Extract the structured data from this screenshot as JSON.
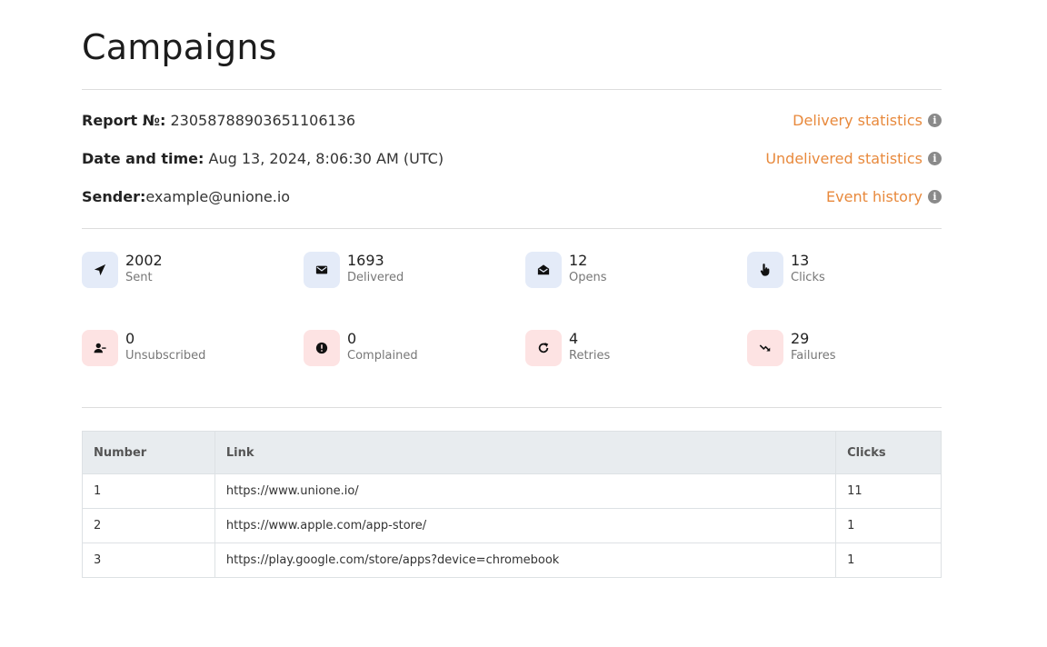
{
  "page": {
    "title": "Campaigns"
  },
  "info": {
    "report": {
      "label": "Report №:",
      "value": "23058788903651106136"
    },
    "datetime": {
      "label": "Date and time:",
      "value": "Aug 13, 2024, 8:06:30 AM (UTC)"
    },
    "sender": {
      "label": "Sender:",
      "value": "example@unione.io"
    },
    "links": {
      "delivery": "Delivery statistics",
      "undelivered": "Undelivered statistics",
      "events": "Event history"
    }
  },
  "stats": [
    {
      "value": "2002",
      "label": "Sent",
      "icon": "send-icon",
      "tone": "blue"
    },
    {
      "value": "1693",
      "label": "Delivered",
      "icon": "envelope-icon",
      "tone": "blue"
    },
    {
      "value": "12",
      "label": "Opens",
      "icon": "envelope-open-icon",
      "tone": "blue"
    },
    {
      "value": "13",
      "label": "Clicks",
      "icon": "pointer-hand-icon",
      "tone": "blue"
    },
    {
      "value": "0",
      "label": "Unsubscribed",
      "icon": "user-minus-icon",
      "tone": "red"
    },
    {
      "value": "0",
      "label": "Complained",
      "icon": "alert-circle-icon",
      "tone": "red"
    },
    {
      "value": "4",
      "label": "Retries",
      "icon": "retry-icon",
      "tone": "red"
    },
    {
      "value": "29",
      "label": "Failures",
      "icon": "trend-down-icon",
      "tone": "red"
    }
  ],
  "colors": {
    "accent": "#e8893c",
    "blue_tile": "#e4ebf8",
    "red_tile": "#fde3e3"
  },
  "table": {
    "headers": {
      "number": "Number",
      "link": "Link",
      "clicks": "Clicks"
    },
    "rows": [
      {
        "number": "1",
        "link": "https://www.unione.io/",
        "clicks": "11"
      },
      {
        "number": "2",
        "link": "https://www.apple.com/app-store/",
        "clicks": "1"
      },
      {
        "number": "3",
        "link": "https://play.google.com/store/apps?device=chromebook",
        "clicks": "1"
      }
    ]
  }
}
